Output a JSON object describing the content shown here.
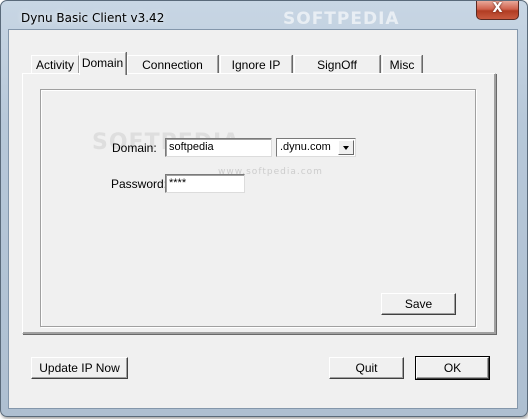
{
  "window": {
    "title": "Dynu Basic Client v3.42",
    "close_glyph": "X"
  },
  "tabs": [
    {
      "label": "Activity",
      "active": false
    },
    {
      "label": "Domain",
      "active": true
    },
    {
      "label": "Connection Type",
      "active": false
    },
    {
      "label": "Ignore IP List",
      "active": false
    },
    {
      "label": "SignOff Settings",
      "active": false
    },
    {
      "label": "Misc",
      "active": false
    }
  ],
  "domain_form": {
    "domain_label": "Domain:",
    "domain_value": "softpedia",
    "domain_suffix": ".dynu.com",
    "password_label": "Password:",
    "password_value": "****",
    "save_label": "Save"
  },
  "footer": {
    "update_label": "Update IP Now",
    "quit_label": "Quit",
    "ok_label": "OK"
  },
  "watermark": {
    "title_text": "SOFTPEDIA",
    "center_text": "SOFTPEDIA",
    "url_text": "www.softpedia.com"
  },
  "colors": {
    "window_frame": "#b7c8d9",
    "close_button": "#c95a3f",
    "dialog_face": "#f0f0f0"
  },
  "icons": {
    "close": "close-icon",
    "dropdown": "chevron-down-icon"
  }
}
